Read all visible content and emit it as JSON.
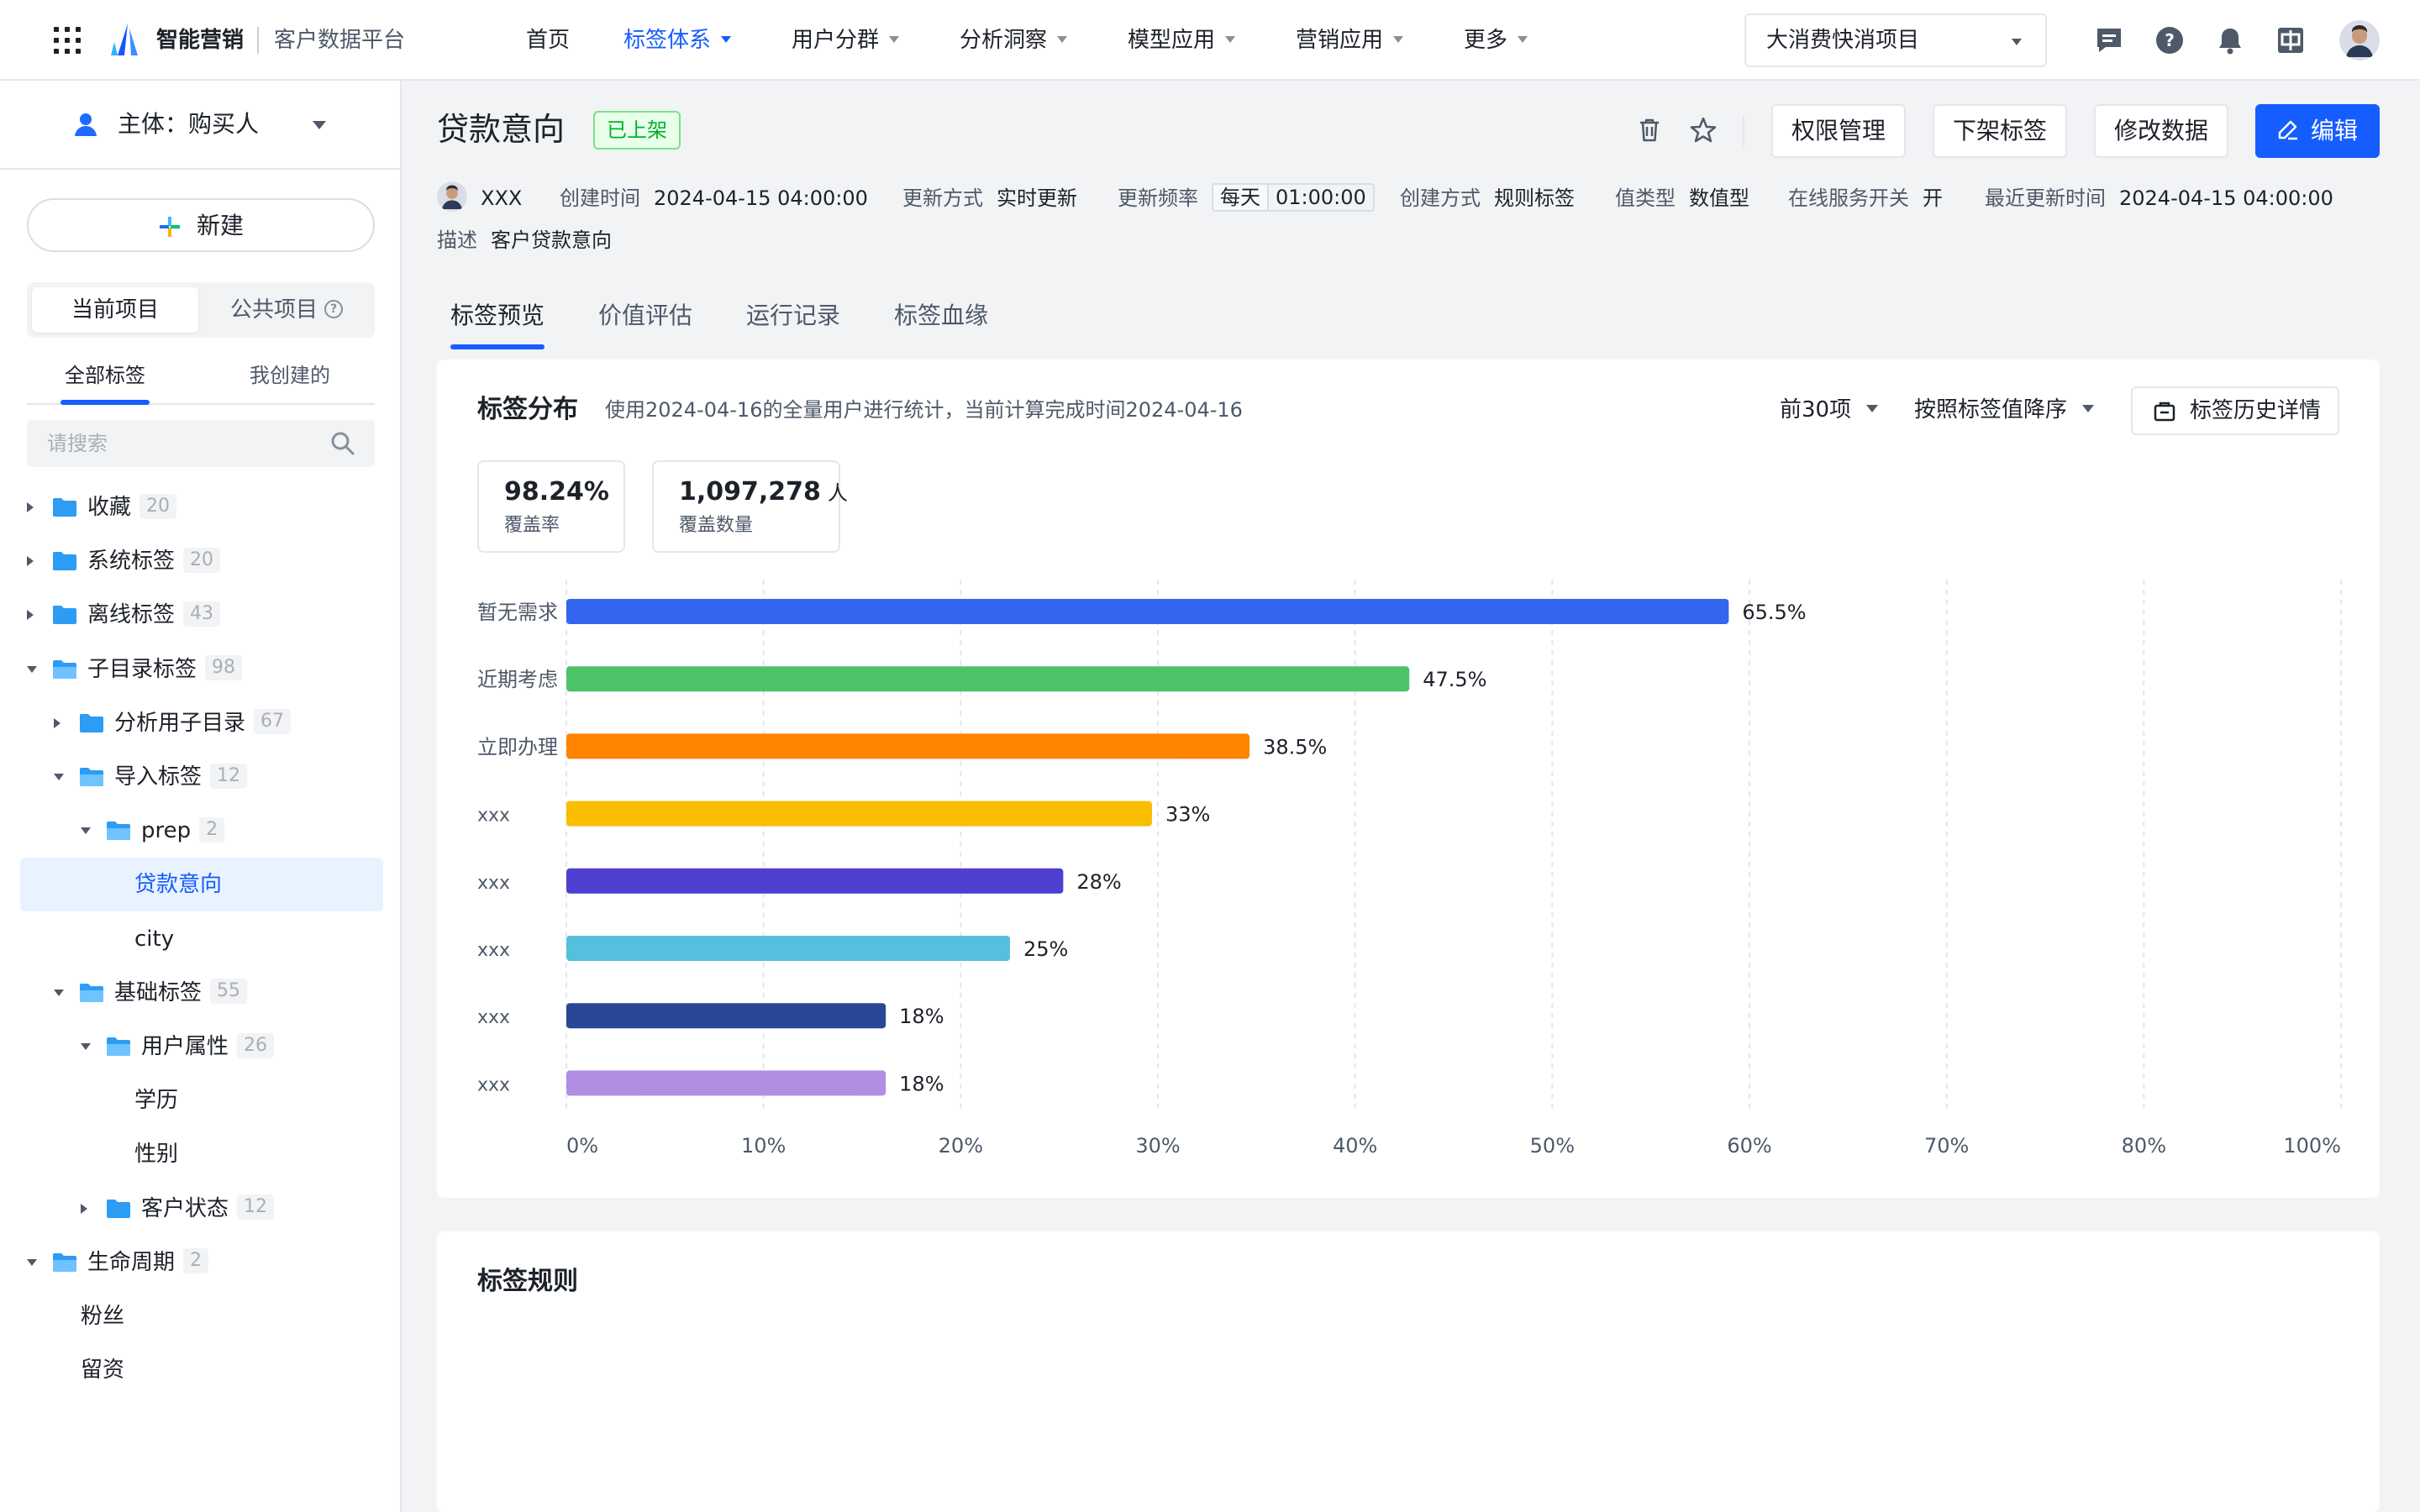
{
  "brand": {
    "name": "智能营销",
    "platform": "客户数据平台"
  },
  "nav": [
    {
      "label": "首页",
      "dropdown": false,
      "active": false
    },
    {
      "label": "标签体系",
      "dropdown": true,
      "active": true
    },
    {
      "label": "用户分群",
      "dropdown": true,
      "active": false
    },
    {
      "label": "分析洞察",
      "dropdown": true,
      "active": false
    },
    {
      "label": "模型应用",
      "dropdown": true,
      "active": false
    },
    {
      "label": "营销应用",
      "dropdown": true,
      "active": false
    },
    {
      "label": "更多",
      "dropdown": true,
      "active": false
    }
  ],
  "project_select": {
    "value": "大消费快消项目"
  },
  "top_icons": [
    "message-icon",
    "help-icon",
    "bell-icon",
    "language-icon"
  ],
  "sidebar": {
    "subject": "主体：购买人",
    "new_label": "新建",
    "segments": [
      "当前项目",
      "公共项目"
    ],
    "tabs": [
      "全部标签",
      "我创建的"
    ],
    "search_placeholder": "请搜索",
    "tree": [
      {
        "label": "收藏",
        "count": "20",
        "level": 0,
        "type": "folder",
        "expanded": false
      },
      {
        "label": "系统标签",
        "count": "20",
        "level": 0,
        "type": "folder",
        "expanded": false
      },
      {
        "label": "离线标签",
        "count": "43",
        "level": 0,
        "type": "folder",
        "expanded": false
      },
      {
        "label": "子目录标签",
        "count": "98",
        "level": 0,
        "type": "folder",
        "expanded": true
      },
      {
        "label": "分析用子目录",
        "count": "67",
        "level": 1,
        "type": "folder",
        "expanded": false
      },
      {
        "label": "导入标签",
        "count": "12",
        "level": 1,
        "type": "folder",
        "expanded": true
      },
      {
        "label": "prep",
        "count": "2",
        "level": 2,
        "type": "folder",
        "expanded": true
      },
      {
        "label": "贷款意向",
        "count": "",
        "level": 3,
        "type": "leaf",
        "selected": true
      },
      {
        "label": "city",
        "count": "",
        "level": 3,
        "type": "leaf"
      },
      {
        "label": "基础标签",
        "count": "55",
        "level": 1,
        "type": "folder",
        "expanded": true
      },
      {
        "label": "用户属性",
        "count": "26",
        "level": 2,
        "type": "folder",
        "expanded": true
      },
      {
        "label": "学历",
        "count": "",
        "level": 3,
        "type": "leaf"
      },
      {
        "label": "性别",
        "count": "",
        "level": 3,
        "type": "leaf"
      },
      {
        "label": "客户状态",
        "count": "12",
        "level": 2,
        "type": "folder",
        "expanded": false
      },
      {
        "label": "生命周期",
        "count": "2",
        "level": 0,
        "type": "folder",
        "expanded": true
      },
      {
        "label": "粉丝",
        "count": "",
        "level": 1,
        "type": "leaf"
      },
      {
        "label": "留资",
        "count": "",
        "level": 1,
        "type": "leaf"
      }
    ]
  },
  "header": {
    "title": "贷款意向",
    "status": "已上架",
    "buttons": {
      "permission": "权限管理",
      "offline": "下架标签",
      "modify": "修改数据",
      "edit": "编辑"
    }
  },
  "meta": {
    "owner": "XXX",
    "created_label": "创建时间",
    "created_value": "2024-04-15 04:00:00",
    "update_mode_label": "更新方式",
    "update_mode_value": "实时更新",
    "freq_label": "更新频率",
    "freq_day": "每天",
    "freq_time": "01:00:00",
    "create_method_label": "创建方式",
    "create_method_value": "规则标签",
    "value_type_label": "值类型",
    "value_type_value": "数值型",
    "online_label": "在线服务开关",
    "online_value": "开",
    "last_update_label": "最近更新时间",
    "last_update_value": "2024-04-15 04:00:00",
    "desc_label": "描述",
    "desc_value": "客户贷款意向"
  },
  "main_tabs": [
    "标签预览",
    "价值评估",
    "运行记录",
    "标签血缘"
  ],
  "distribution": {
    "title": "标签分布",
    "desc": "使用2024-04-16的全量用户进行统计，当前计算完成时间2024-04-16",
    "top_n": "前30项",
    "sort": "按照标签值降序",
    "history_btn": "标签历史详情",
    "coverage_rate": "98.24%",
    "coverage_rate_label": "覆盖率",
    "coverage_count": "1,097,278",
    "coverage_unit": "人",
    "coverage_count_label": "覆盖数量"
  },
  "rules": {
    "title": "标签规则"
  },
  "colors": {
    "accent": "#165dff",
    "success": "#00b42a",
    "folder": "#2d9cf5"
  },
  "chart_data": {
    "type": "bar",
    "orientation": "horizontal",
    "categories": [
      "暂无需求",
      "近期考虑",
      "立即办理",
      "xxx",
      "xxx",
      "xxx",
      "xxx",
      "xxx"
    ],
    "values": [
      65.5,
      47.5,
      38.5,
      33,
      28,
      25,
      18,
      18
    ],
    "value_labels": [
      "65.5%",
      "47.5%",
      "38.5%",
      "33%",
      "28%",
      "25%",
      "18%",
      "18%"
    ],
    "colors": [
      "#3366ee",
      "#4cc366",
      "#ff8400",
      "#f9be00",
      "#4f3fd0",
      "#55c0dd",
      "#2a4797",
      "#b08ee3"
    ],
    "xlim": [
      0,
      100
    ],
    "xticks": [
      "0%",
      "10%",
      "20%",
      "30%",
      "40%",
      "50%",
      "60%",
      "70%",
      "80%",
      "100%"
    ],
    "grid": true
  }
}
